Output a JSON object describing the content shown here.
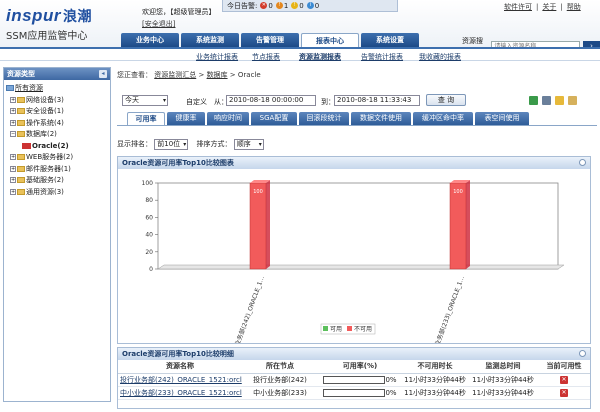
{
  "header": {
    "logo": "inspur",
    "logo_cn": "浪潮",
    "subtitle": "SSM应用监管中心",
    "welcome": "欢迎您，【超级管理员】",
    "logout": "[安全退出]",
    "alerts_label": "今日告警:",
    "alerts": [
      {
        "icon": "critical-alert-icon",
        "color": "#d23b2b",
        "count": "0",
        "symbol": "✕"
      },
      {
        "icon": "major-alert-icon",
        "color": "#e4881f",
        "count": "1",
        "symbol": "!"
      },
      {
        "icon": "minor-alert-icon",
        "color": "#e7b417",
        "count": "0",
        "symbol": "!"
      },
      {
        "icon": "info-alert-icon",
        "color": "#3c8bd3",
        "count": "0",
        "symbol": "i"
      }
    ],
    "links": [
      "软件许可",
      "关于",
      "帮助"
    ],
    "nav": [
      "业务中心",
      "系统监测",
      "告警管理",
      "报表中心",
      "系统设置"
    ],
    "nav_active": "报表中心",
    "search_label": "资源搜索",
    "search_placeholder": "请输入资源名称",
    "search_go": "›"
  },
  "subnav": [
    {
      "label": "业务统计报表",
      "active": false
    },
    {
      "label": "节点报表",
      "active": false
    },
    {
      "label": "资源监测报表",
      "active": true
    },
    {
      "label": "告警统计报表",
      "active": false
    },
    {
      "label": "我收藏的报表",
      "active": false
    }
  ],
  "sidebar": {
    "title": "资源类型",
    "items": [
      {
        "label": "所有资源",
        "level": 0,
        "type": "root"
      },
      {
        "label": "网络设备(3)",
        "level": 1,
        "type": "folder"
      },
      {
        "label": "安全设备(1)",
        "level": 1,
        "type": "folder"
      },
      {
        "label": "操作系统(4)",
        "level": 1,
        "type": "folder"
      },
      {
        "label": "数据库(2)",
        "level": 1,
        "type": "folder-open"
      },
      {
        "label": "Oracle(2)",
        "level": 2,
        "type": "db"
      },
      {
        "label": "WEB服务器(2)",
        "level": 1,
        "type": "folder"
      },
      {
        "label": "邮件服务器(1)",
        "level": 1,
        "type": "folder"
      },
      {
        "label": "基础服务(2)",
        "level": 1,
        "type": "folder"
      },
      {
        "label": "通用资源(3)",
        "level": 1,
        "type": "folder"
      }
    ]
  },
  "main": {
    "breadcrumb_prefix": "您正查看：",
    "breadcrumb": [
      "资源监测汇总",
      "数据库",
      "Oracle"
    ],
    "period": "今天",
    "custom_label": "自定义",
    "from_label": "从：",
    "from": "2010-08-18 00:00:00",
    "to_label": "到：",
    "to": "2010-08-18 11:33:43",
    "query": "查 询",
    "tabs": [
      "可用率",
      "健康率",
      "响应时间",
      "SGA配置",
      "回滚段统计",
      "数据文件使用",
      "缓冲区命中率",
      "表空间使用"
    ],
    "active_tab": "可用率",
    "rank_label": "显示排名：",
    "rank_value": "前10位",
    "sort_label": "排序方式：",
    "sort_value": "顺序",
    "chart_panel_title": "Oracle资源可用率Top10比较图表",
    "table_panel_title": "Oracle资源可用率Top10比较明细",
    "table": {
      "headers": [
        "资源名称",
        "所在节点",
        "可用率(%)",
        "不可用时长",
        "监测总时间",
        "当前可用性"
      ],
      "rows": [
        {
          "name": "投行业务部(242)_ORACLE_1521:orcl",
          "node": "投行业务部(242)",
          "rate": "0%",
          "down": "11小时33分钟44秒",
          "total": "11小时33分钟44秒",
          "status": "unavailable"
        },
        {
          "name": "中小业务部(233)_ORACLE_1521:orcl",
          "node": "中小业务部(233)",
          "rate": "0%",
          "down": "11小时33分钟44秒",
          "total": "11小时33分钟44秒",
          "status": "unavailable"
        }
      ]
    }
  },
  "chart_data": {
    "type": "bar",
    "categories": [
      "投行业务部(242)_ORACLE_1...",
      "中小业务部(233)_ORACLE_1..."
    ],
    "series": [
      {
        "name": "可用",
        "values": [
          0,
          0
        ],
        "color": "#5cbf5c"
      },
      {
        "name": "不可用",
        "values": [
          100,
          100
        ],
        "color": "#f25b5b"
      }
    ],
    "data_labels": [
      "100",
      "100"
    ],
    "yticks": [
      "0",
      "20",
      "40",
      "60",
      "80",
      "100"
    ],
    "ylim": [
      0,
      100
    ]
  }
}
